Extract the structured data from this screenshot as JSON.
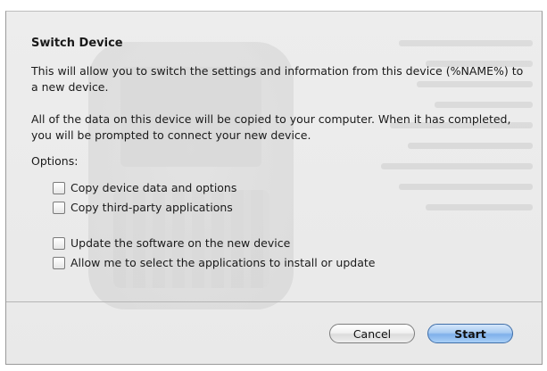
{
  "dialog": {
    "title": "Switch Device",
    "paragraph1": "This will allow you to switch the settings and information from this device (%NAME%) to a new device.",
    "paragraph2": "All of the data on this device will be copied to your computer. When it has completed, you will be prompted to connect your new device.",
    "options_label": "Options:",
    "options": [
      {
        "label": "Copy device data and options",
        "checked": false
      },
      {
        "label": "Copy third-party applications",
        "checked": false
      },
      {
        "label": "Update the software on the new device",
        "checked": false
      },
      {
        "label": "Allow me to select the applications to install or update",
        "checked": false
      }
    ],
    "buttons": {
      "cancel": "Cancel",
      "start": "Start"
    }
  }
}
